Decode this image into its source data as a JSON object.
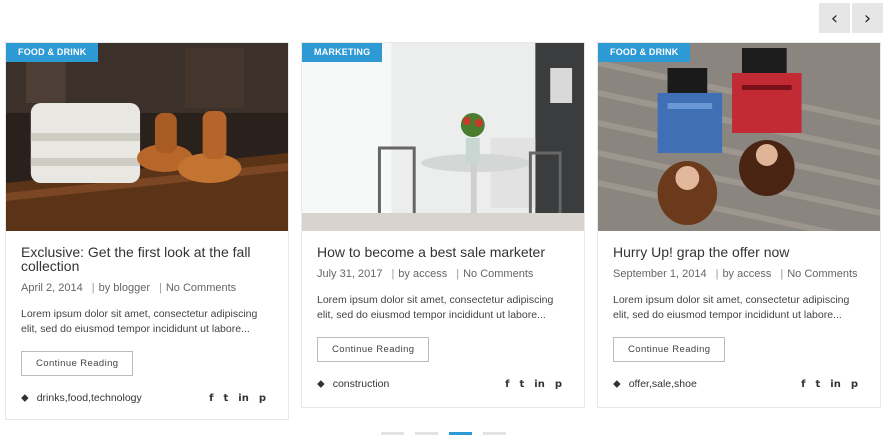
{
  "carousel": {
    "prev_icon": "chevron-left-icon",
    "next_icon": "chevron-right-icon",
    "active_dot": 2,
    "dots": 4
  },
  "accent_color": "#2d9ad6",
  "posts": [
    {
      "category": "FOOD & DRINK",
      "title": "Exclusive: Get the first look at the fall collection",
      "date": "April 2, 2014",
      "author": "by blogger",
      "comments": "No Comments",
      "excerpt": "Lorem ipsum dolor sit amet, consectetur adipiscing elit, sed do eiusmod tempor incididunt ut labore...",
      "button": "Continue Reading",
      "tags": "drinks,food,technology"
    },
    {
      "category": "MARKETING",
      "title": "How to become a best sale marketer",
      "date": "July 31, 2017",
      "author": "by access",
      "comments": "No Comments",
      "excerpt": "Lorem ipsum dolor sit amet, consectetur adipiscing elit, sed do eiusmod tempor incididunt ut labore...",
      "button": "Continue Reading",
      "tags": "construction"
    },
    {
      "category": "FOOD & DRINK",
      "title": "Hurry Up! grap the offer now",
      "date": "September 1, 2014",
      "author": "by access",
      "comments": "No Comments",
      "excerpt": "Lorem ipsum dolor sit amet, consectetur adipiscing elit, sed do eiusmod tempor incididunt ut labore...",
      "button": "Continue Reading",
      "tags": "offer,sale,shoe"
    }
  ],
  "social": {
    "facebook": "f",
    "twitter": "t",
    "linkedin": "in",
    "pinterest": "p"
  }
}
